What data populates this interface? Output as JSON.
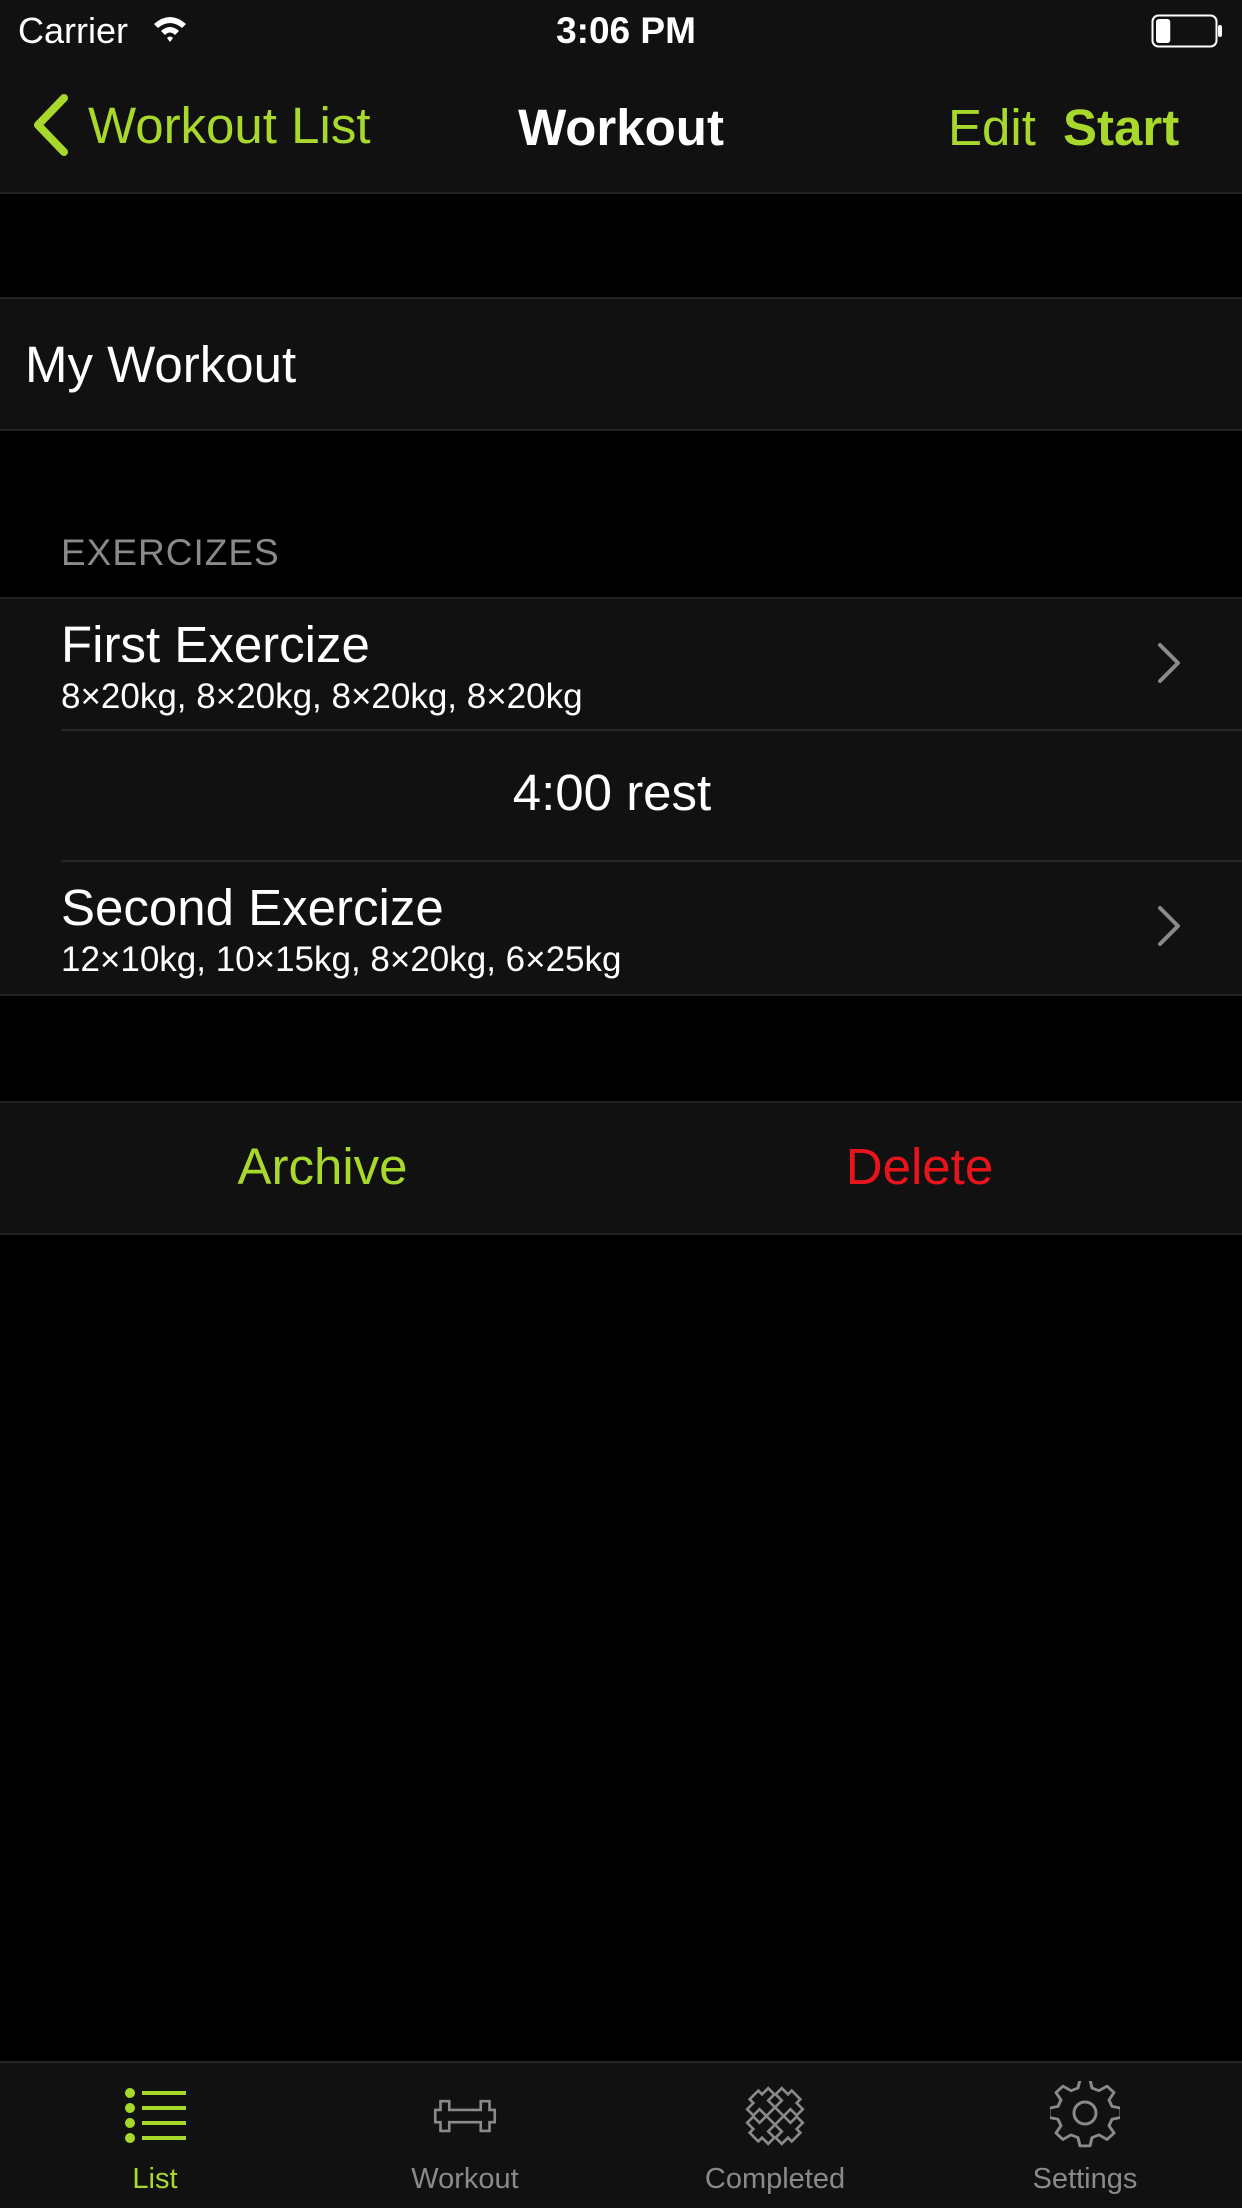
{
  "status_bar": {
    "carrier": "Carrier",
    "time": "3:06 PM",
    "battery_level": 0.25
  },
  "nav": {
    "back_label": "Workout List",
    "title": "Workout",
    "edit_label": "Edit",
    "start_label": "Start"
  },
  "workout": {
    "name": "My Workout"
  },
  "exercises": {
    "header": "EXERCIZES",
    "items": [
      {
        "title": "First Exercize",
        "sets": "8×20kg, 8×20kg, 8×20kg, 8×20kg"
      },
      {
        "title": "Second Exercize",
        "sets": "12×10kg, 10×15kg, 8×20kg, 6×25kg"
      }
    ],
    "rest": "4:00 rest"
  },
  "actions": {
    "archive_label": "Archive",
    "delete_label": "Delete"
  },
  "tabs": [
    {
      "label": "List",
      "icon": "list-icon",
      "active": true
    },
    {
      "label": "Workout",
      "icon": "dumbbell-icon",
      "active": false
    },
    {
      "label": "Completed",
      "icon": "completed-dumbbell-icon",
      "active": false
    },
    {
      "label": "Settings",
      "icon": "gear-icon",
      "active": false
    }
  ],
  "colors": {
    "accent": "#a8d82c",
    "destructive": "#e8141c",
    "background": "#000000",
    "cell": "#111111",
    "secondary_text": "#8a8a8a"
  }
}
